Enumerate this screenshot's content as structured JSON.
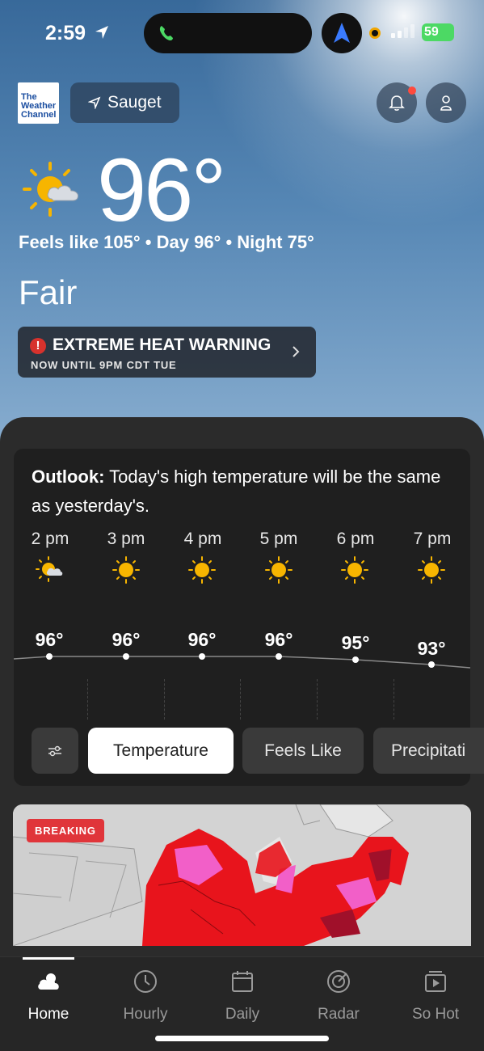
{
  "status_bar": {
    "time": "2:59",
    "battery": "59"
  },
  "header": {
    "logo_line1": "The",
    "logo_line2": "Weather",
    "logo_line3": "Channel",
    "location": "Sauget"
  },
  "current": {
    "temperature": "96°",
    "feels_line": "Feels like 105° • Day 96° • Night 75°",
    "condition": "Fair",
    "icon": "partly-sunny-icon"
  },
  "alert": {
    "title": "EXTREME HEAT WARNING",
    "subtitle": "NOW UNTIL 9PM CDT TUE",
    "color": "#d7322d"
  },
  "outlook": {
    "label": "Outlook:",
    "text": "Today's high temperature will be the same as yesterday's."
  },
  "hourly": [
    {
      "time": "2 pm",
      "temp": "96°",
      "icon": "partly-sunny-icon"
    },
    {
      "time": "3 pm",
      "temp": "96°",
      "icon": "sun-icon"
    },
    {
      "time": "4 pm",
      "temp": "96°",
      "icon": "sun-icon"
    },
    {
      "time": "5 pm",
      "temp": "96°",
      "icon": "sun-icon"
    },
    {
      "time": "6 pm",
      "temp": "95°",
      "icon": "sun-icon"
    },
    {
      "time": "7 pm",
      "temp": "93°",
      "icon": "sun-icon"
    }
  ],
  "chips": {
    "temperature": "Temperature",
    "feels_like": "Feels Like",
    "precipitation": "Precipitati"
  },
  "map": {
    "badge": "BREAKING"
  },
  "tabs": [
    {
      "label": "Home",
      "icon": "cloud-icon"
    },
    {
      "label": "Hourly",
      "icon": "clock-icon"
    },
    {
      "label": "Daily",
      "icon": "calendar-icon"
    },
    {
      "label": "Radar",
      "icon": "radar-icon"
    },
    {
      "label": "So Hot",
      "icon": "video-icon"
    }
  ],
  "colors": {
    "accent_sun": "#f7b500",
    "heat_red": "#e8141c",
    "heat_pink": "#f25fc8"
  }
}
